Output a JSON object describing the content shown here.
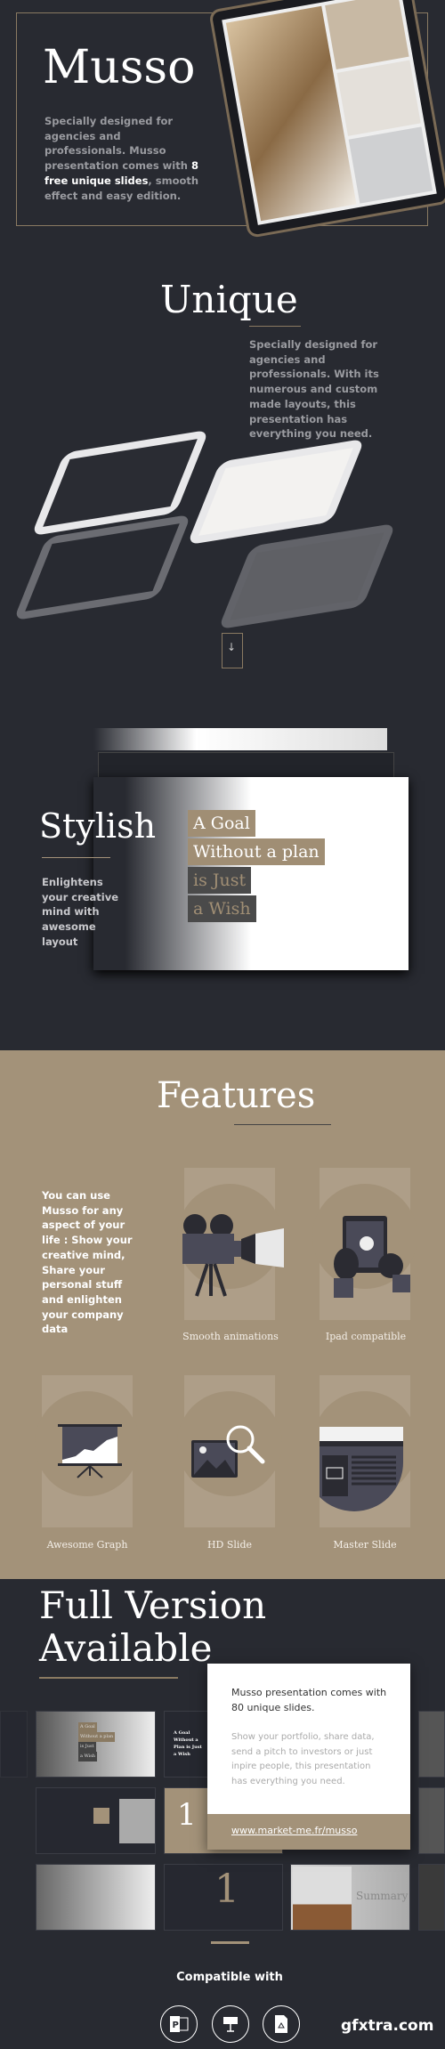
{
  "hero": {
    "title": "Musso",
    "text_pre": "Specially designed for agencies and professionals. Musso presentation comes with ",
    "text_bold": "8 free unique slides",
    "text_post": ", smooth effect and easy edition.",
    "device_logo": "1S"
  },
  "unique": {
    "title": "Unique",
    "text": "Specially designed for agencies and professionals. With its numerous and custom made layouts, this presentation has everything you need.",
    "scroll_icon": "arrow-down-icon"
  },
  "stylish": {
    "title": "Stylish",
    "text": "Enlightens your creative mind with awesome layout",
    "quote": [
      "A Goal",
      "Without a plan",
      "is Just",
      "a Wish"
    ]
  },
  "features": {
    "title": "Features",
    "text": "You can use Musso for any aspect of your life : Show your creative mind, Share your personal stuff and enlighten your company data",
    "items": [
      {
        "label": "Smooth animations",
        "icon": "video-camera-icon"
      },
      {
        "label": "Ipad compatible",
        "icon": "tablet-touch-icon"
      },
      {
        "label": "Awesome Graph",
        "icon": "presentation-graph-icon"
      },
      {
        "label": "HD Slide",
        "icon": "image-zoom-icon"
      },
      {
        "label": "Master Slide",
        "icon": "browser-layout-icon"
      }
    ]
  },
  "full": {
    "title_line1": "Full Version",
    "title_line2": "Available",
    "card_title": "Musso presentation comes with 80 unique slides.",
    "card_text": "Show your portfolio, share data, send a pitch to investors or just inpire people, this presentation has everything you need.",
    "link": "www.market-me.fr/musso",
    "thumbs": {
      "goal": [
        "A Goal",
        "Without a plan",
        "is Just",
        "a Wish"
      ],
      "goal2": "A Goal Without a Plan is Just a Wish",
      "number": "1",
      "summary": "Summary"
    }
  },
  "compatible": {
    "title": "Compatible with",
    "apps": [
      "powerpoint-icon",
      "keynote-icon",
      "google-slides-icon"
    ]
  },
  "watermark": "gfxtra.com",
  "colors": {
    "bg": "#282a31",
    "accent": "#a39279",
    "dark_box": "#4a4a4a"
  }
}
